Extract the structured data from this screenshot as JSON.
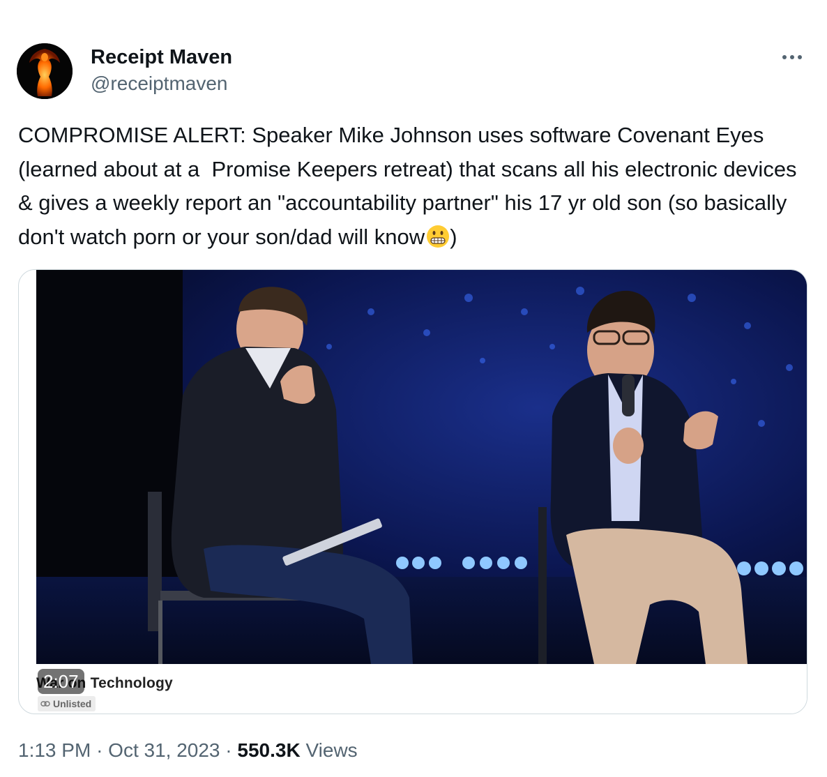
{
  "author": {
    "display_name": "Receipt Maven",
    "handle": "@receiptmaven",
    "avatar_icon": "flame-dancer-avatar"
  },
  "more_icon": "more-horizontal-icon",
  "tweet": {
    "text": "COMPROMISE ALERT: Speaker Mike Johnson uses software Covenant Eyes (learned about at a  Promise Keepers retreat) that scans all his electronic devices & gives a weekly report an \"accountability partner\" his 17 yr old son (so basically don't watch porn or your son/dad will know",
    "emoji": "grimacing-face",
    "text_end": ")"
  },
  "media": {
    "duration": "2:07",
    "title": "War on Technology",
    "badge": "Unlisted",
    "badge_icon": "link-icon"
  },
  "meta": {
    "time": "1:13 PM",
    "separator": "·",
    "date": "Oct 31, 2023",
    "views_count": "550.3K",
    "views_label": "Views"
  },
  "colors": {
    "text": "#0f1419",
    "secondary": "#536471",
    "border": "#cfd9de"
  }
}
